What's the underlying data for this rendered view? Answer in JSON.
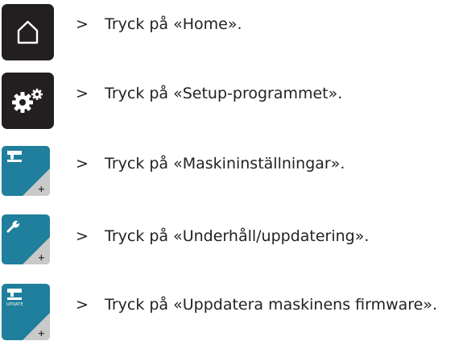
{
  "steps": [
    {
      "chevron": ">",
      "text": "Tryck på «Home»."
    },
    {
      "chevron": ">",
      "text": "Tryck på «Setup-programmet»."
    },
    {
      "chevron": ">",
      "text": "Tryck på «Maskininställningar»."
    },
    {
      "chevron": ">",
      "text": "Tryck på «Underhåll/uppdatering»."
    },
    {
      "chevron": ">",
      "text": "Tryck på «Uppdatera maskinens firmware»."
    }
  ],
  "buttons": {
    "plus": "+",
    "update_label": "UPDATE"
  },
  "colors": {
    "dark_button": "#231f20",
    "blue_button": "#1f7f9c",
    "corner": "#c9c9c9"
  },
  "icons": [
    "home-icon",
    "settings-gears-icon",
    "sewing-machine-icon",
    "wrench-icon",
    "update-icon"
  ]
}
